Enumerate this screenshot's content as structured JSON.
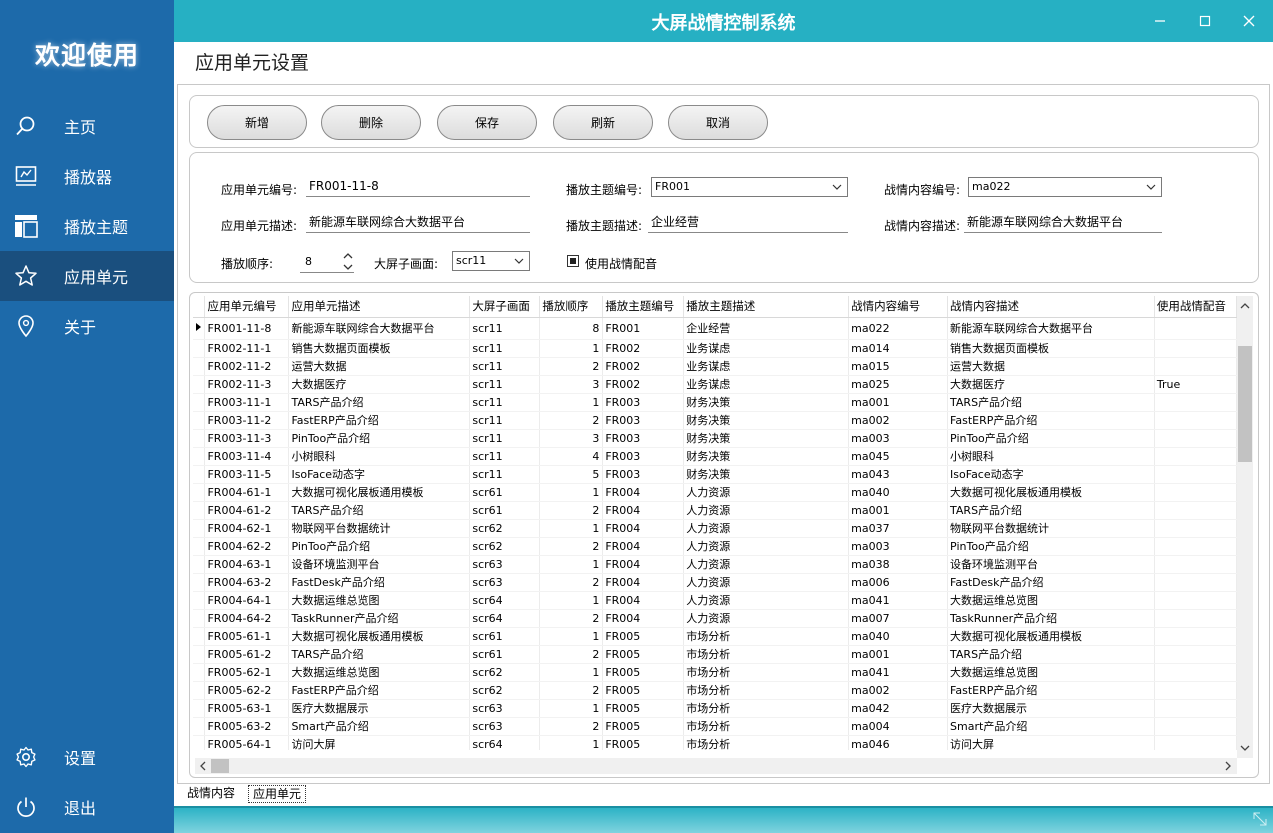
{
  "app": {
    "title": "大屏战情控制系统",
    "welcome": "欢迎使用",
    "accent": "#26b0c3",
    "sidebar_color": "#1d6aaa"
  },
  "sidebar": {
    "items": [
      {
        "label": "主页",
        "icon": "search-icon"
      },
      {
        "label": "播放器",
        "icon": "monitor-icon"
      },
      {
        "label": "播放主题",
        "icon": "layout-icon"
      },
      {
        "label": "应用单元",
        "icon": "star-icon",
        "active": true
      },
      {
        "label": "关于",
        "icon": "location-pin-icon"
      }
    ],
    "bottom": [
      {
        "label": "设置",
        "icon": "gear-icon"
      },
      {
        "label": "退出",
        "icon": "power-icon"
      }
    ]
  },
  "page": {
    "title": "应用单元设置"
  },
  "toolbar": {
    "add": "新增",
    "delete": "删除",
    "save": "保存",
    "refresh": "刷新",
    "cancel": "取消"
  },
  "form": {
    "unit_code_label": "应用单元编号:",
    "unit_code_value": "FR001-11-8",
    "unit_desc_label": "应用单元描述:",
    "unit_desc_value": "新能源车联网综合大数据平台",
    "order_label": "播放顺序:",
    "order_value": "8",
    "subscreen_label": "大屏子画面:",
    "subscreen_value": "scr11",
    "theme_code_label": "播放主题编号:",
    "theme_code_value": "FR001",
    "theme_desc_label": "播放主题描述:",
    "theme_desc_value": "企业经营",
    "use_audio_label": "使用战情配音",
    "content_code_label": "战情内容编号:",
    "content_code_value": "ma022",
    "content_desc_label": "战情内容描述:",
    "content_desc_value": "新能源车联网综合大数据平台"
  },
  "grid": {
    "headers": [
      "应用单元编号",
      "应用单元描述",
      "大屏子画面",
      "播放顺序",
      "播放主题编号",
      "播放主题描述",
      "战情内容编号",
      "战情内容描述",
      "使用战情配音"
    ],
    "rows": [
      [
        "FR001-11-8",
        "新能源车联网综合大数据平台",
        "scr11",
        "8",
        "FR001",
        "企业经营",
        "ma022",
        "新能源车联网综合大数据平台",
        ""
      ],
      [
        "FR002-11-1",
        "销售大数据页面模板",
        "scr11",
        "1",
        "FR002",
        "业务谋虑",
        "ma014",
        "销售大数据页面模板",
        ""
      ],
      [
        "FR002-11-2",
        "运营大数据",
        "scr11",
        "2",
        "FR002",
        "业务谋虑",
        "ma015",
        "运营大数据",
        ""
      ],
      [
        "FR002-11-3",
        "大数据医疗",
        "scr11",
        "3",
        "FR002",
        "业务谋虑",
        "ma025",
        "大数据医疗",
        "True"
      ],
      [
        "FR003-11-1",
        "TARS产品介绍",
        "scr11",
        "1",
        "FR003",
        "财务决策",
        "ma001",
        "TARS产品介绍",
        ""
      ],
      [
        "FR003-11-2",
        "FastERP产品介绍",
        "scr11",
        "2",
        "FR003",
        "财务决策",
        "ma002",
        "FastERP产品介绍",
        ""
      ],
      [
        "FR003-11-3",
        "PinToo产品介绍",
        "scr11",
        "3",
        "FR003",
        "财务决策",
        "ma003",
        "PinToo产品介绍",
        ""
      ],
      [
        "FR003-11-4",
        "小树眼科",
        "scr11",
        "4",
        "FR003",
        "财务决策",
        "ma045",
        "小树眼科",
        ""
      ],
      [
        "FR003-11-5",
        "IsoFace动态字",
        "scr11",
        "5",
        "FR003",
        "财务决策",
        "ma043",
        "IsoFace动态字",
        ""
      ],
      [
        "FR004-61-1",
        "大数据可视化展板通用模板",
        "scr61",
        "1",
        "FR004",
        "人力资源",
        "ma040",
        "大数据可视化展板通用模板",
        ""
      ],
      [
        "FR004-61-2",
        "TARS产品介绍",
        "scr61",
        "2",
        "FR004",
        "人力资源",
        "ma001",
        "TARS产品介绍",
        ""
      ],
      [
        "FR004-62-1",
        "物联网平台数据统计",
        "scr62",
        "1",
        "FR004",
        "人力资源",
        "ma037",
        "物联网平台数据统计",
        ""
      ],
      [
        "FR004-62-2",
        "PinToo产品介绍",
        "scr62",
        "2",
        "FR004",
        "人力资源",
        "ma003",
        "PinToo产品介绍",
        ""
      ],
      [
        "FR004-63-1",
        "设备环境监测平台",
        "scr63",
        "1",
        "FR004",
        "人力资源",
        "ma038",
        "设备环境监测平台",
        ""
      ],
      [
        "FR004-63-2",
        "FastDesk产品介绍",
        "scr63",
        "2",
        "FR004",
        "人力资源",
        "ma006",
        "FastDesk产品介绍",
        ""
      ],
      [
        "FR004-64-1",
        "大数据运维总览图",
        "scr64",
        "1",
        "FR004",
        "人力资源",
        "ma041",
        "大数据运维总览图",
        ""
      ],
      [
        "FR004-64-2",
        "TaskRunner产品介绍",
        "scr64",
        "2",
        "FR004",
        "人力资源",
        "ma007",
        "TaskRunner产品介绍",
        ""
      ],
      [
        "FR005-61-1",
        "大数据可视化展板通用模板",
        "scr61",
        "1",
        "FR005",
        "市场分析",
        "ma040",
        "大数据可视化展板通用模板",
        ""
      ],
      [
        "FR005-61-2",
        "TARS产品介绍",
        "scr61",
        "2",
        "FR005",
        "市场分析",
        "ma001",
        "TARS产品介绍",
        ""
      ],
      [
        "FR005-62-1",
        "大数据运维总览图",
        "scr62",
        "1",
        "FR005",
        "市场分析",
        "ma041",
        "大数据运维总览图",
        ""
      ],
      [
        "FR005-62-2",
        "FastERP产品介绍",
        "scr62",
        "2",
        "FR005",
        "市场分析",
        "ma002",
        "FastERP产品介绍",
        ""
      ],
      [
        "FR005-63-1",
        "医疗大数据展示",
        "scr63",
        "1",
        "FR005",
        "市场分析",
        "ma042",
        "医疗大数据展示",
        ""
      ],
      [
        "FR005-63-2",
        "Smart产品介绍",
        "scr63",
        "2",
        "FR005",
        "市场分析",
        "ma004",
        "Smart产品介绍",
        ""
      ],
      [
        "FR005-64-1",
        "访问大屏",
        "scr64",
        "1",
        "FR005",
        "市场分析",
        "ma046",
        "访问大屏",
        ""
      ]
    ]
  },
  "tabs": [
    "战情内容",
    "应用单元"
  ]
}
